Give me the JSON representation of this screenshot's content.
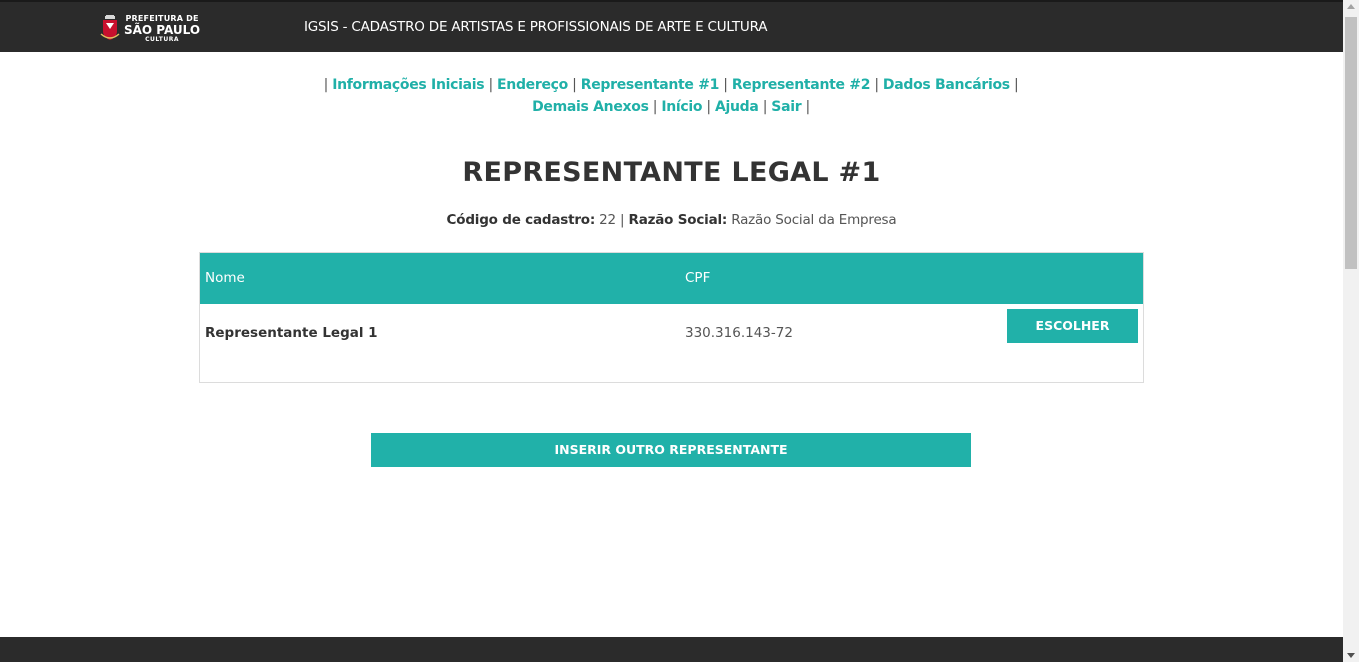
{
  "header": {
    "logo": {
      "top": "PREFEITURA DE",
      "main": "SÃO PAULO",
      "sub": "CULTURA"
    },
    "title": "IGSIS - CADASTRO DE ARTISTAS E PROFISSIONAIS DE ARTE E CULTURA"
  },
  "nav": {
    "items": [
      "Informações Iniciais",
      "Endereço",
      "Representante #1",
      "Representante #2",
      "Dados Bancários",
      "Demais Anexos",
      "Início",
      "Ajuda",
      "Sair"
    ],
    "separator": "|"
  },
  "main": {
    "title": "REPRESENTANTE LEGAL #1",
    "info": {
      "code_label": "Código de cadastro:",
      "code_value": "22",
      "separator": "|",
      "company_label": "Razão Social:",
      "company_value": "Razão Social da Empresa"
    },
    "table": {
      "headers": [
        "Nome",
        "CPF"
      ],
      "rows": [
        {
          "nome": "Representante Legal 1",
          "cpf": "330.316.143-72",
          "action": "ESCOLHER"
        }
      ]
    },
    "insert_button": "INSERIR OUTRO REPRESENTANTE"
  },
  "colors": {
    "accent": "#21b1a9",
    "header_bg": "#2b2b2b"
  }
}
